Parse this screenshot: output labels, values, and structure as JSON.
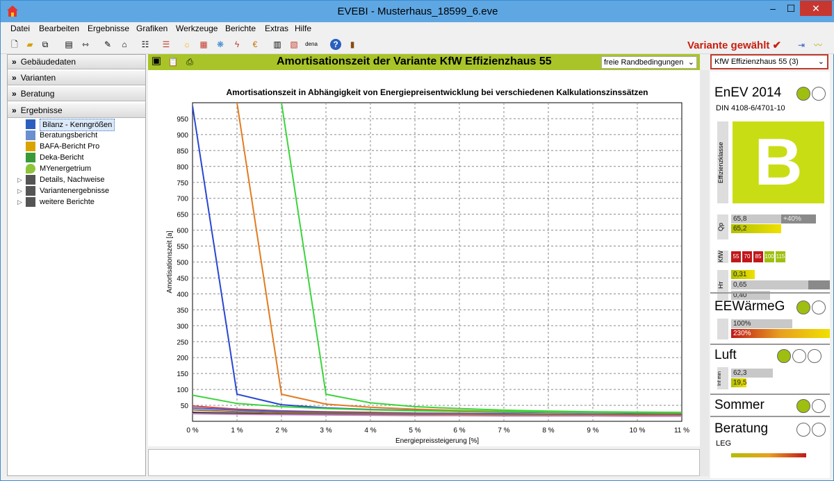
{
  "window": {
    "title": "EVEBI - Musterhaus_18599_6.eve",
    "buttons": [
      "–",
      "☐",
      "✕"
    ]
  },
  "menu": [
    "Datei",
    "Bearbeiten",
    "Ergebnisse",
    "Grafiken",
    "Werkzeuge",
    "Berichte",
    "Extras",
    "Hilfe"
  ],
  "toolbar": {
    "variant_chosen": "Variante gewählt",
    "dena": "dena"
  },
  "left": {
    "sections": [
      "Gebäudedaten",
      "Varianten",
      "Beratung",
      "Ergebnisse"
    ],
    "tree": [
      "Bilanz - Kenngrößen",
      "Beratungsbericht",
      "BAFA-Bericht Pro",
      "Deka-Bericht",
      "MYenergetrium",
      "Details, Nachweise",
      "Variantenergebnisse",
      "weitere Berichte"
    ]
  },
  "center": {
    "header": "Amortisationszeit der Variante KfW Effizienzhaus 55",
    "condition": "freie Randbedingungen"
  },
  "chart_data": {
    "type": "line",
    "title": "Amortisationszeit in Abhängigkeit von Energiepreisentwicklung bei verschiedenen Kalkulationszinssätzen",
    "xlabel": "Energiepreissteigerung [%]",
    "ylabel": "Amortisationszeit [a]",
    "x": [
      0,
      1,
      2,
      3,
      4,
      5,
      6,
      7,
      8,
      9,
      10,
      11
    ],
    "xticks": [
      "0 %",
      "1 %",
      "2 %",
      "3 %",
      "4 %",
      "5 %",
      "6 %",
      "7 %",
      "8 %",
      "9 %",
      "10 %",
      "11 %"
    ],
    "yticks": [
      50,
      100,
      150,
      200,
      250,
      300,
      350,
      400,
      450,
      500,
      550,
      600,
      650,
      700,
      750,
      800,
      850,
      900,
      950
    ],
    "xlim": [
      0,
      11
    ],
    "ylim": [
      0,
      1000
    ],
    "grid": true,
    "series": [
      {
        "color": "#2846d2",
        "values": [
          990,
          85,
          52,
          42,
          37,
          34,
          31,
          29,
          28,
          27,
          26,
          25
        ]
      },
      {
        "color": "#e27b1f",
        "values": [
          null,
          null,
          85,
          54,
          44,
          38,
          34,
          31,
          29,
          28,
          27,
          26
        ]
      },
      {
        "color": "#3ad43a",
        "values": [
          null,
          null,
          null,
          85,
          58,
          46,
          40,
          35,
          32,
          30,
          29,
          28
        ]
      },
      {
        "color": "#3ad43a",
        "values": [
          82,
          56,
          46,
          40,
          36,
          33,
          31,
          30,
          29,
          28,
          27,
          27
        ]
      },
      {
        "color": "#d64040",
        "values": [
          48,
          38,
          33,
          30,
          28,
          26,
          25,
          24,
          23,
          22,
          22,
          21
        ]
      },
      {
        "color": "#4060d0",
        "values": [
          42,
          35,
          31,
          28,
          26,
          25,
          24,
          23,
          22,
          21,
          21,
          20
        ]
      },
      {
        "color": "#303030",
        "values": [
          28,
          25,
          23,
          22,
          21,
          20,
          20,
          19,
          19,
          18,
          18,
          18
        ]
      },
      {
        "color": "#9e6b2f",
        "values": [
          36,
          30,
          27,
          25,
          24,
          23,
          22,
          21,
          21,
          20,
          20,
          19
        ]
      },
      {
        "color": "#c080c0",
        "values": [
          24,
          22,
          21,
          20,
          19,
          18,
          18,
          17,
          17,
          17,
          16,
          16
        ]
      }
    ]
  },
  "right": {
    "variant": "KfW Effizienzhaus 55 (3)",
    "enev": {
      "title": "EnEV 2014",
      "sub": "DIN 4108-6/4701-10",
      "classLabel": "Effizienzklasse",
      "class": "B",
      "qp": "Qp",
      "qp1": "65,8",
      "qp_pct": "+40%",
      "qp2": "65,2",
      "kfw": "KfW",
      "kfwvals": [
        "55",
        "70",
        "85",
        "100",
        "115"
      ],
      "ht1": "0,31",
      "ht2": "0,65",
      "ht3": "0,40"
    },
    "ee": {
      "title": "EEWärmeG",
      "v1": "100%",
      "v2": "230%"
    },
    "luft": {
      "title": "Luft",
      "lab": "Inf min",
      "v1": "62,3",
      "v2": "19,5"
    },
    "sommer": {
      "title": "Sommer"
    },
    "beratung": {
      "title": "Beratung",
      "sub": "LEG"
    }
  }
}
